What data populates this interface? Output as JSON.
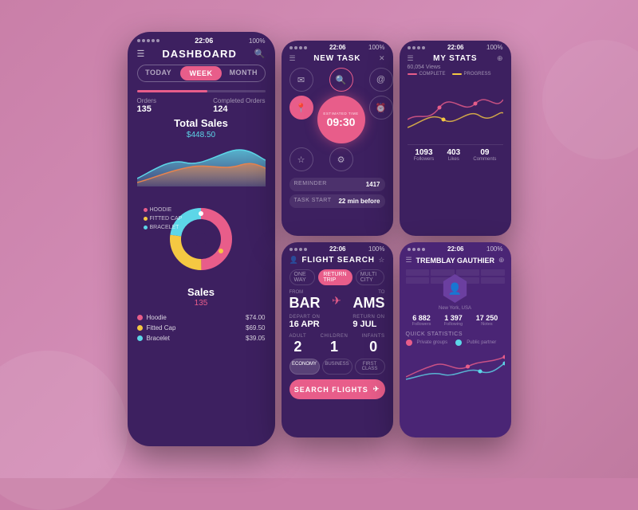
{
  "dashboard": {
    "status_dots": "•••••",
    "time": "22:06",
    "battery": "100%",
    "title": "DASHBOARD",
    "tabs": [
      "TODAY",
      "WEEK",
      "MONTH"
    ],
    "active_tab": "WEEK",
    "orders_label": "Orders",
    "orders_num": "135",
    "completed_label": "Completed Orders",
    "completed_num": "124",
    "total_sales_title": "Total Sales",
    "total_sales_amount": "$448.50",
    "sales_title": "Sales",
    "sales_num": "135",
    "legend": [
      {
        "label": "Hoodie",
        "price": "$74.00",
        "color": "#e85d8a"
      },
      {
        "label": "Fitted Cap",
        "price": "$69.50",
        "color": "#f5c842"
      },
      {
        "label": "Bracelet",
        "price": "$39.05",
        "color": "#5dd6e8"
      }
    ],
    "donut_labels": [
      "HOODIE",
      "FITTED CAP",
      "BRACELET"
    ]
  },
  "new_task": {
    "title": "NEW TASK",
    "timer_label": "ESTIMATED TIME",
    "timer_value": "09:30",
    "reminder_label": "REMINDER",
    "reminder_val": "1417",
    "task_start_label": "TASK START",
    "task_start_val": "22 min before"
  },
  "my_stats": {
    "title": "MY STATS",
    "views": "60,054 Views",
    "legend_1": "COMPLETE",
    "legend_2": "PROGRESS",
    "followers": "1093",
    "followers_label": "Followers",
    "likes": "403",
    "likes_label": "Likes",
    "comments": "09",
    "comments_label": "Comments"
  },
  "flight_search": {
    "title": "FLIGHT SEARCH",
    "tab_one_way": "ONE WAY",
    "tab_return": "RETURN TRIP",
    "tab_multi": "MULTI CITY",
    "from_label": "FROM",
    "from_city": "BAR",
    "to_label": "TO",
    "to_city": "AMS",
    "depart_label": "DEPART ON",
    "depart_date": "16 APR",
    "return_label": "RETURN ON",
    "return_date": "9 JUL",
    "adult_label": "ADULT",
    "adult_num": "2",
    "children_label": "CHILDREN",
    "children_num": "1",
    "infants_label": "INFANTS",
    "infants_num": "0",
    "class_economy": "ECONOMY",
    "class_business": "BUSINESS",
    "class_first": "FIRST CLASS",
    "search_btn": "SEARCH FLIGHTS"
  },
  "profile": {
    "title": "TREMBLAY GAUTHIER",
    "location": "New York, USA",
    "followers_num": "6 882",
    "followers_label": "Followers",
    "following_num": "1 397",
    "following_label": "Following",
    "notes_num": "17 250",
    "notes_label": "Notes",
    "quick_stats_title": "QUICK STATISTICS",
    "private_groups": "Private groups",
    "public_partner": "Public partner"
  },
  "icons": {
    "hamburger": "☰",
    "search": "🔍",
    "plus": "✦",
    "close": "✕",
    "star": "☆",
    "pin": "📍",
    "mail": "✉",
    "bell": "🔔",
    "clock": "⏰",
    "settings": "⚙",
    "check": "✓",
    "plane": "✈"
  },
  "colors": {
    "bg_dark": "#3d2060",
    "bg_medium": "#4a2570",
    "pink": "#e85d8a",
    "cyan": "#5dd6e8",
    "yellow": "#f5c842",
    "orange": "#e8834d"
  }
}
